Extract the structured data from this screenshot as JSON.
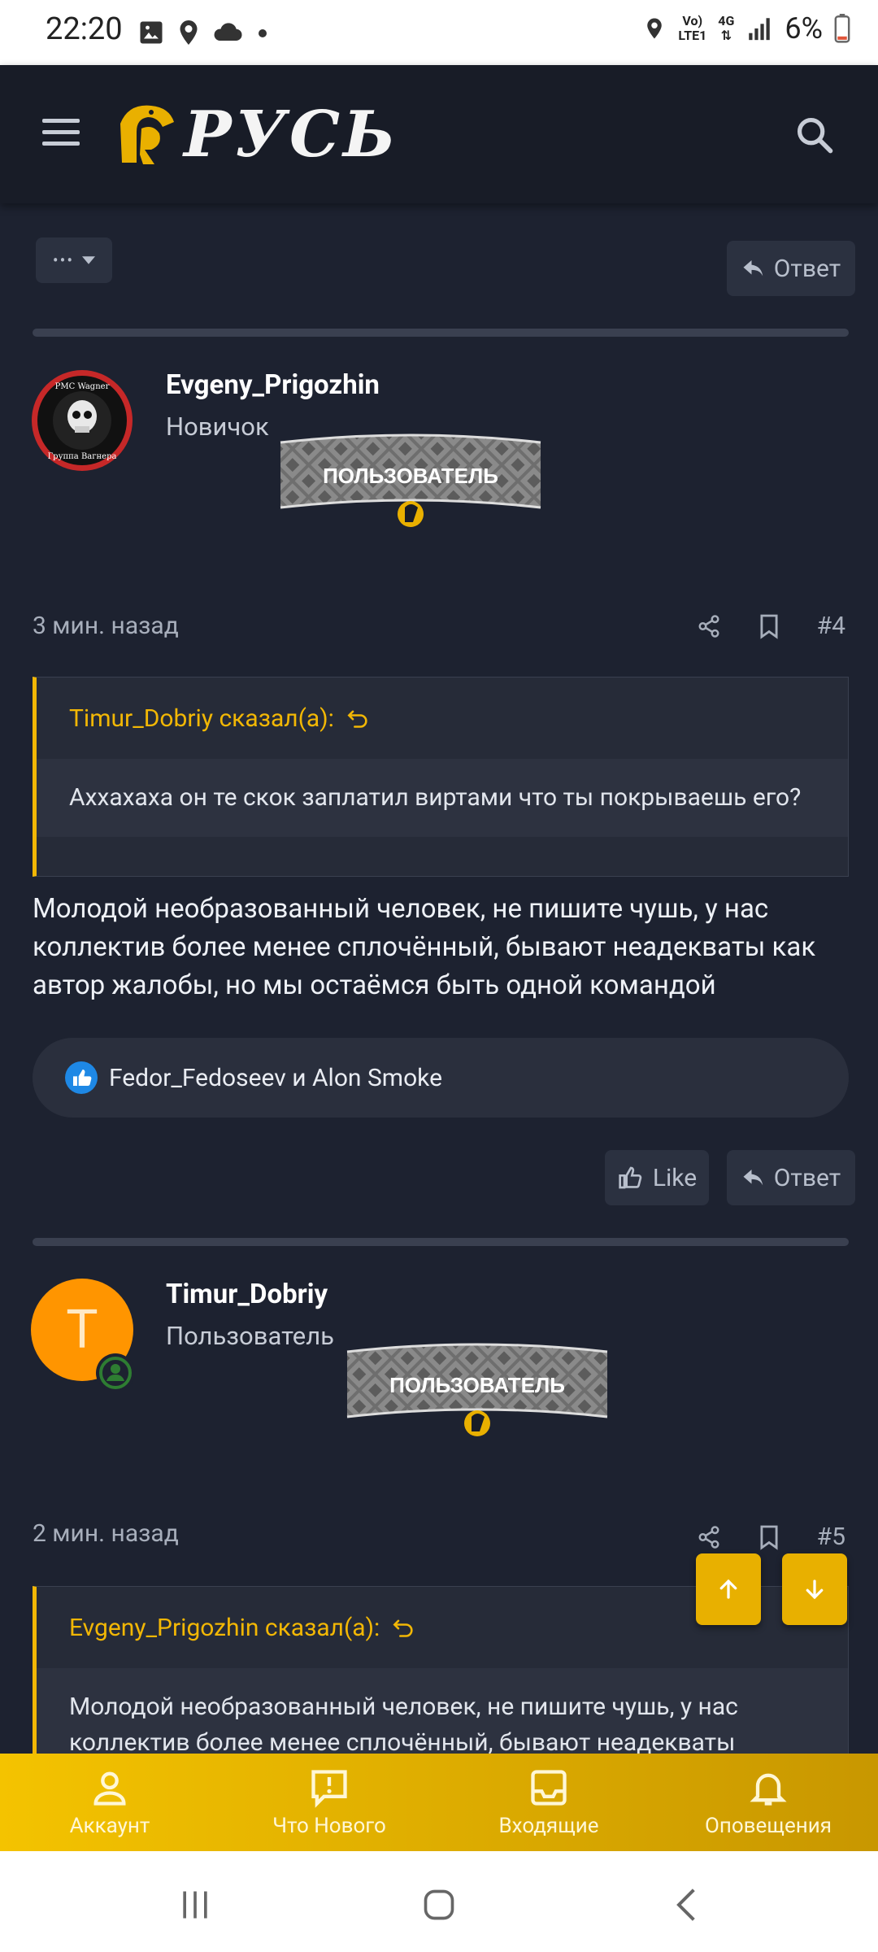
{
  "status_bar": {
    "time": "22:20",
    "network": "4G",
    "carrier_top": "Vo)",
    "carrier_bottom": "LTE1",
    "battery": "6%"
  },
  "header": {
    "logo_text": "РУСЬ"
  },
  "toolbar": {
    "more_label": "•••",
    "reply_label": "Ответ"
  },
  "posts": [
    {
      "username": "Evgeny_Prigozhin",
      "role": "Новичок",
      "banner": "ПОЛЬЗОВАТЕЛЬ",
      "time": "3 мин. назад",
      "number": "#4",
      "quote_author": "Timur_Dobriy сказал(а):",
      "quote_text": "Аххахаха он те скок заплатил виртами что ты покрываешь его?",
      "message": "Молодой необразованный человек, не пишите чушь, у нас коллектив более менее сплочённый, бывают неадекваты как автор жалобы, но мы остаёмся быть одной командой",
      "reactions": "Fedor_Fedoseev и Alon Smoke",
      "like_label": "Like",
      "reply_label": "Ответ"
    },
    {
      "username": "Timur_Dobriy",
      "avatar_letter": "T",
      "role": "Пользователь",
      "banner": "ПОЛЬЗОВАТЕЛЬ",
      "time": "2 мин. назад",
      "number": "#5",
      "quote_author": "Evgeny_Prigozhin сказал(а):",
      "quote_text": "Молодой необразованный человек, не пишите чушь, у нас коллектив более менее сплочённый, бывают неадекваты"
    }
  ],
  "bottom_nav": [
    {
      "label": "Аккаунт",
      "icon": "user-icon"
    },
    {
      "label": "Что Нового",
      "icon": "news-icon"
    },
    {
      "label": "Входящие",
      "icon": "inbox-icon"
    },
    {
      "label": "Оповещения",
      "icon": "bell-icon"
    }
  ],
  "colors": {
    "accent": "#f2b705",
    "background": "#1d2230",
    "header": "#181c27",
    "avatar_orange": "#ff9500"
  }
}
